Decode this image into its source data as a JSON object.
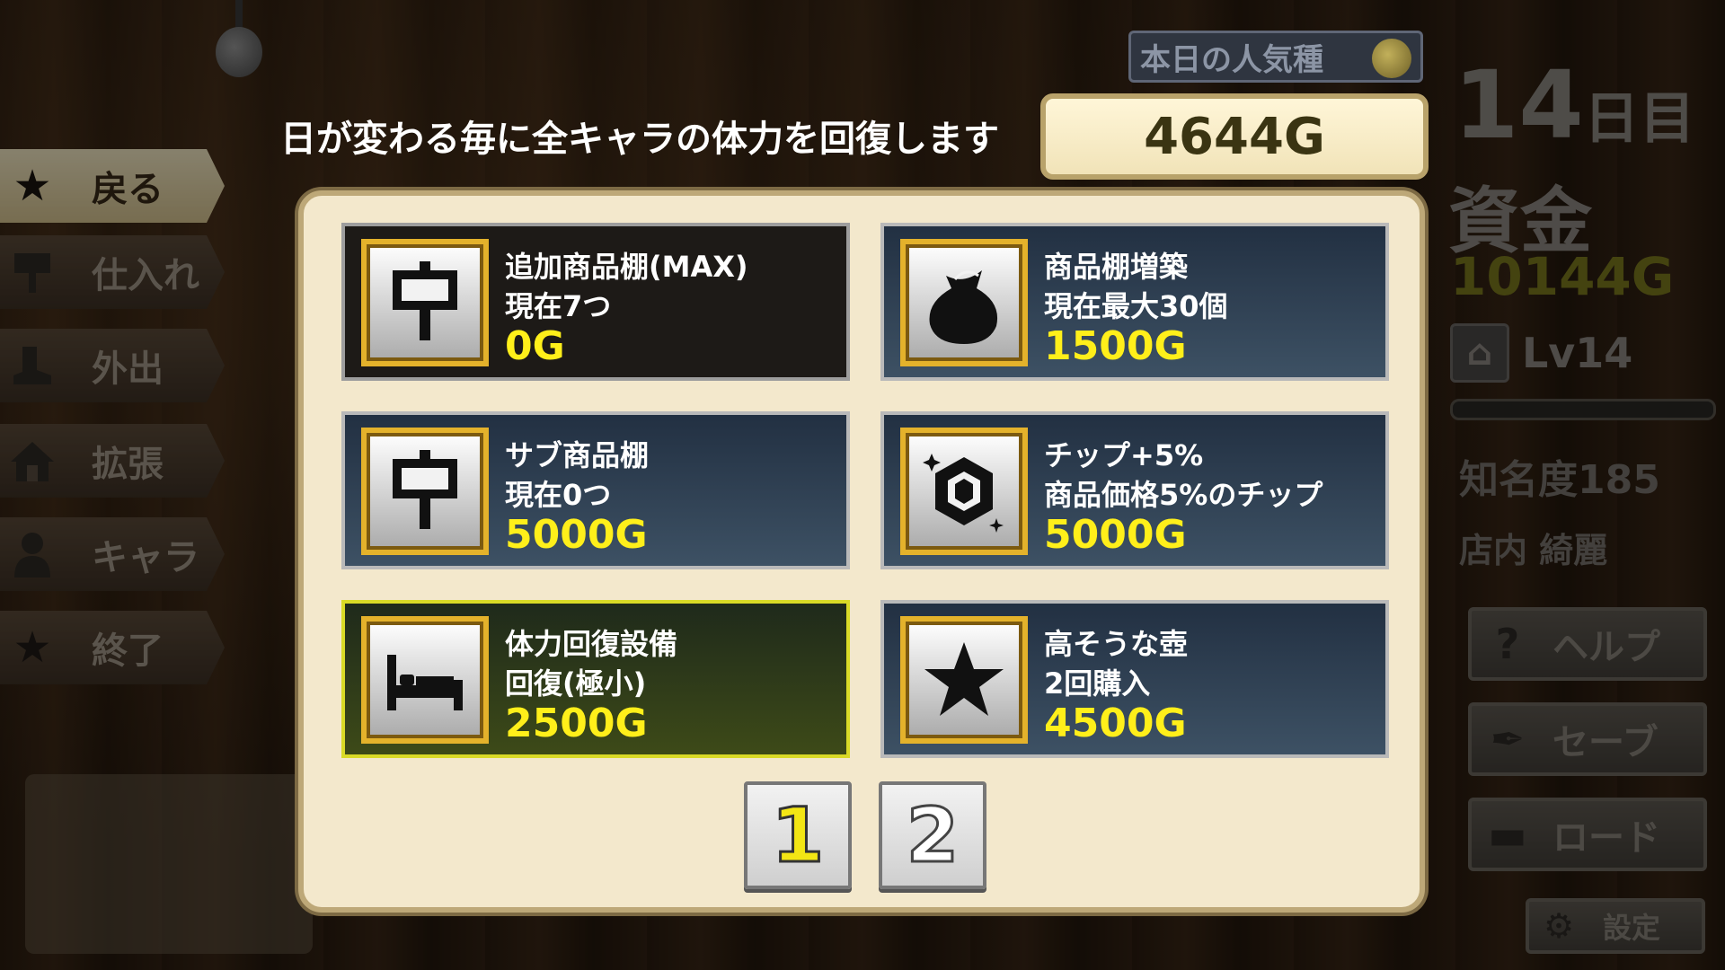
{
  "header": {
    "info": "日が変わる毎に全キャラの体力を回復します",
    "money": "4644G",
    "popular": "本日の人気種"
  },
  "menu": [
    {
      "label": "戻る",
      "icon": "star-icon"
    },
    {
      "label": "仕入れ",
      "icon": "signboard-icon"
    },
    {
      "label": "外出",
      "icon": "boot-icon"
    },
    {
      "label": "拡張",
      "icon": "house-icon"
    },
    {
      "label": "キャラ",
      "icon": "person-icon"
    },
    {
      "label": "終了",
      "icon": "star-icon"
    }
  ],
  "status": {
    "day_num": "14",
    "day_unit": "日目",
    "funds_label": "資金",
    "funds_value": "10144G",
    "level": "Lv14",
    "fame": "知名度185",
    "cleanliness": "店内 綺麗"
  },
  "side_buttons": [
    {
      "label": "ヘルプ",
      "icon": "question-icon"
    },
    {
      "label": "セーブ",
      "icon": "feather-icon"
    },
    {
      "label": "ロード",
      "icon": "book-icon"
    },
    {
      "label": "設定",
      "icon": "gear-icon"
    }
  ],
  "items": [
    {
      "name": "追加商品棚(MAX)",
      "detail": "現在7つ",
      "price": "0G",
      "icon": "signboard-icon",
      "state": "owned"
    },
    {
      "name": "商品棚増築",
      "detail": "現在最大30個",
      "price": "1500G",
      "icon": "bag-icon",
      "state": "normal"
    },
    {
      "name": "サブ商品棚",
      "detail": "現在0つ",
      "price": "5000G",
      "icon": "signboard-icon",
      "state": "normal"
    },
    {
      "name": "チップ+5%",
      "detail": "商品価格5%のチップ",
      "price": "5000G",
      "icon": "gem-icon",
      "state": "normal"
    },
    {
      "name": "体力回復設備",
      "detail": "回復(極小)",
      "price": "2500G",
      "icon": "bed-icon",
      "state": "selected"
    },
    {
      "name": "高そうな壺",
      "detail": "2回購入",
      "price": "4500G",
      "icon": "star-icon",
      "state": "normal"
    }
  ],
  "pagination": [
    "1",
    "2"
  ],
  "colors": {
    "price": "#ffef1a",
    "selected_border": "#d9da27",
    "frame": "#e4b22b"
  }
}
